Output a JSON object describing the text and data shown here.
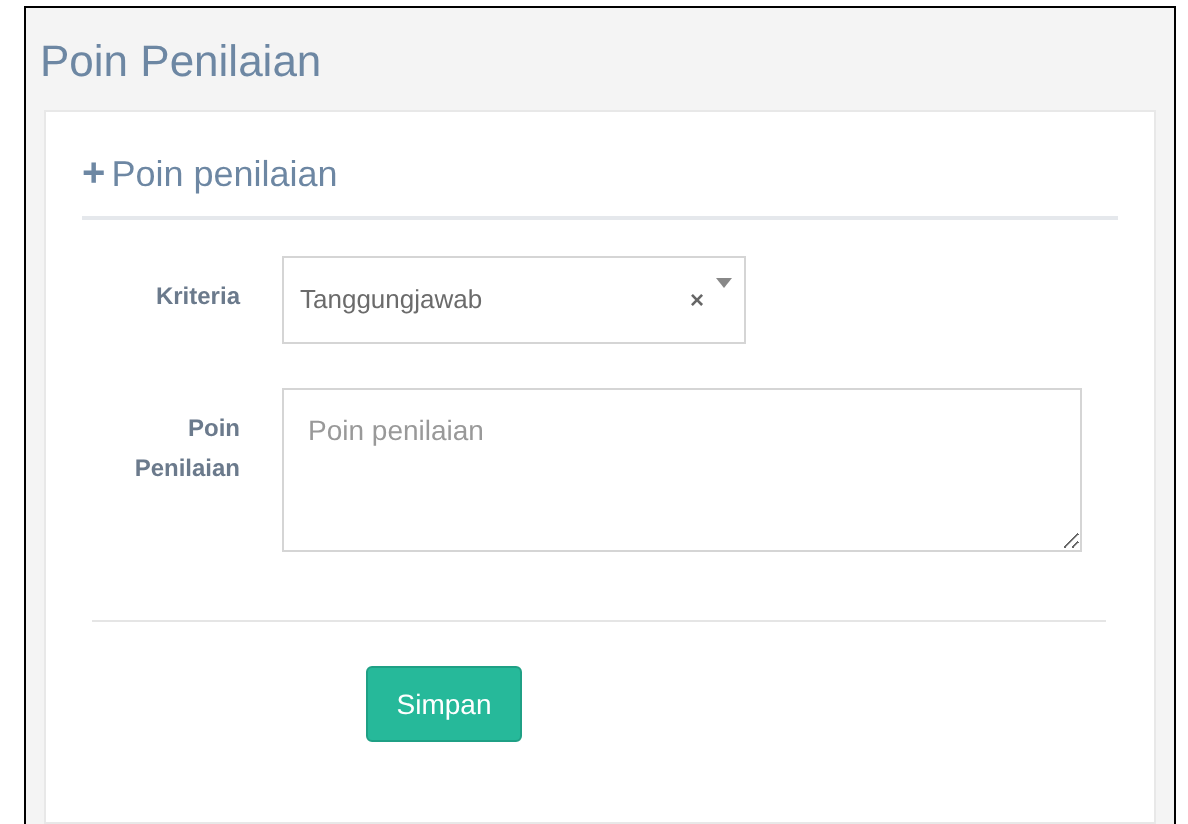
{
  "page_title": "Poin Penilaian",
  "panel": {
    "icon": "+",
    "title": "Poin penilaian"
  },
  "fields": [
    {
      "kind": "select",
      "label": "Kriteria",
      "value": "Tanggungjawab",
      "clear": "×"
    },
    {
      "kind": "textarea",
      "label": "Poin Penilaian",
      "placeholder": "Poin penilaian"
    }
  ],
  "submit": "Simpan"
}
